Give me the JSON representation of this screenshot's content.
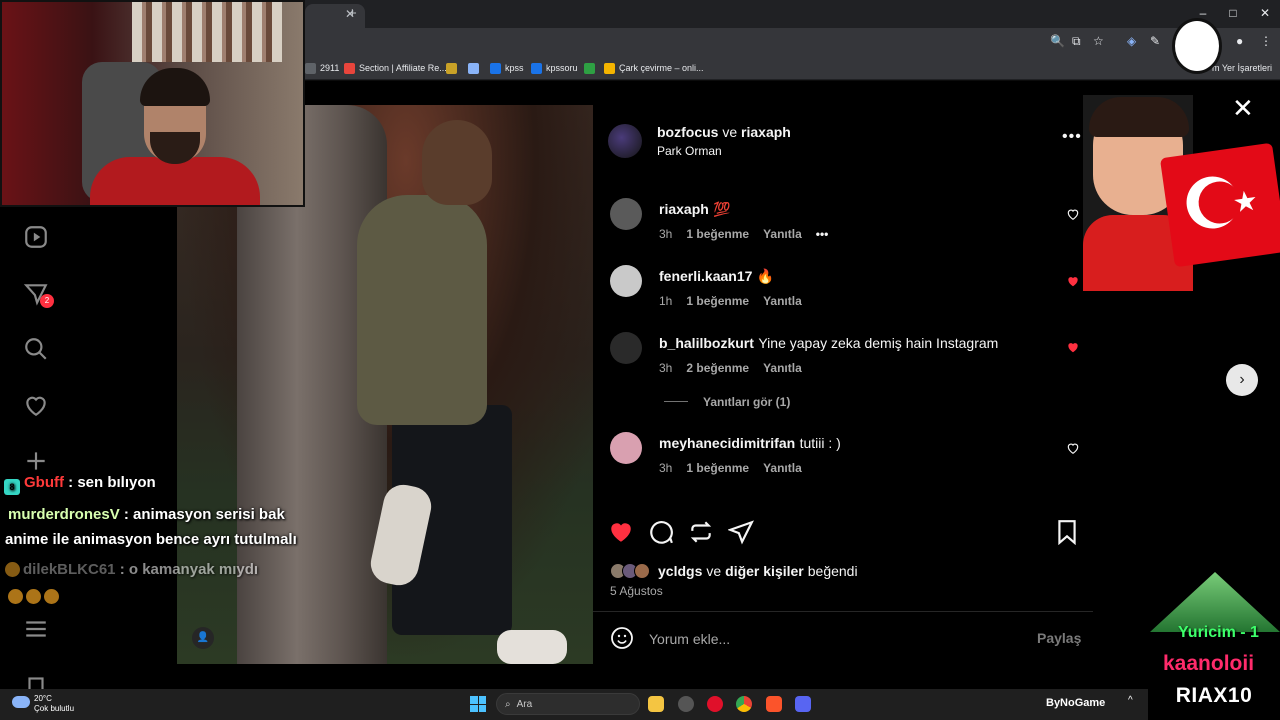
{
  "browser": {
    "window_controls": {
      "minimize": "–",
      "maximize": "□",
      "close": "✕"
    },
    "bookmarks": [
      {
        "label": "2911",
        "color": "#5f6368"
      },
      {
        "label": "Section | Affiliate Re...",
        "color": "#e8453c"
      },
      {
        "label": "",
        "color": "#c9a227"
      },
      {
        "label": "",
        "color": "#8ab4f8"
      },
      {
        "label": "kpss",
        "color": "#1a73e8"
      },
      {
        "label": "kpssoru",
        "color": "#1a73e8"
      },
      {
        "label": "",
        "color": "#2ea043"
      },
      {
        "label": "Çark çevirme – onli...",
        "color": "#f4b400"
      }
    ],
    "bookmarks_overflow": "m Yer İşaretleri"
  },
  "sidebar": {
    "notification_count": "2"
  },
  "post": {
    "header_user1": "bozfocus",
    "header_and": "ve",
    "header_user2": "riaxaph",
    "location": "Park Orman",
    "more_label": "•••",
    "comments": [
      {
        "user": "riaxaph",
        "text": "💯",
        "time": "3h",
        "likes": "1 beğenme",
        "reply": "Yanıtla",
        "liked": false,
        "avatar": "#5a5a5a"
      },
      {
        "user": "fenerli.kaan17",
        "text": "🔥",
        "time": "1h",
        "likes": "1 beğenme",
        "reply": "Yanıtla",
        "liked": true,
        "avatar": "#c9c9c9"
      },
      {
        "user": "b_halilbozkurt",
        "text": "Yine yapay zeka demiş hain Instagram",
        "time": "3h",
        "likes": "2 beğenme",
        "reply": "Yanıtla",
        "liked": true,
        "avatar": "#2a2a2a"
      },
      {
        "user": "meyhanecidimitrifan",
        "text": "tutiii : )",
        "time": "3h",
        "likes": "1 beğenme",
        "reply": "Yanıtla",
        "liked": false,
        "avatar": "#d9a0b0"
      }
    ],
    "view_replies": "Yanıtları gör (1)",
    "liked_by_user": "ycldgs",
    "liked_by_and": "ve",
    "liked_by_others": "diğer kişiler",
    "liked_by_suffix": "beğendi",
    "date": "5 Ağustos",
    "comment_placeholder": "Yorum ekle...",
    "share_label": "Paylaş",
    "close_label": "✕",
    "next_label": "›"
  },
  "chat": [
    {
      "name": "Gbuff",
      "message": ": sen bılıyon"
    },
    {
      "name": "murderdronesV",
      "message": ": animasyon serisi bak"
    },
    {
      "name": "",
      "message": "anime ile animasyon bence ayrı tutulmalı"
    },
    {
      "name": "dilekBLKC61",
      "message": ": o kamanyak mıydı"
    }
  ],
  "overlays": {
    "goal_text": "Yuricim - 1",
    "follower_name": "kaanoloii",
    "code_big": "RIAX10",
    "sticker_colors": {
      "flag": "#e30a17"
    }
  },
  "taskbar": {
    "temperature": "20°C",
    "weather": "Çok bulutlu",
    "search_placeholder": "Ara",
    "brand": "ByNoGame",
    "tray_chevron": "^"
  }
}
